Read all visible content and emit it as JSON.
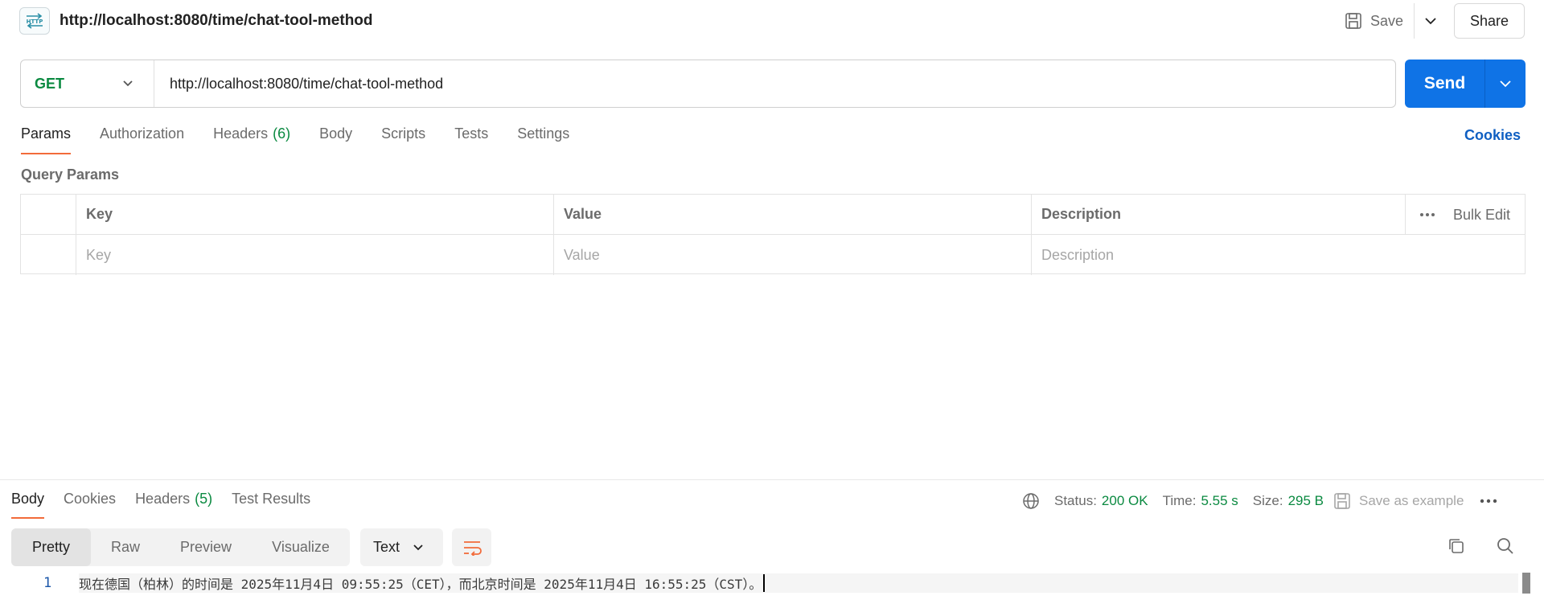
{
  "header": {
    "title": "http://localhost:8080/time/chat-tool-method",
    "save_label": "Save",
    "share_label": "Share"
  },
  "request": {
    "method": "GET",
    "url": "http://localhost:8080/time/chat-tool-method",
    "send_label": "Send"
  },
  "tabs": {
    "params": "Params",
    "authorization": "Authorization",
    "headers": "Headers",
    "headers_count": "(6)",
    "body": "Body",
    "scripts": "Scripts",
    "tests": "Tests",
    "settings": "Settings",
    "cookies": "Cookies"
  },
  "query_params": {
    "label": "Query Params",
    "columns": {
      "key": "Key",
      "value": "Value",
      "description": "Description"
    },
    "bulk_edit": "Bulk Edit",
    "placeholders": {
      "key": "Key",
      "value": "Value",
      "description": "Description"
    }
  },
  "response": {
    "tabs": {
      "body": "Body",
      "cookies": "Cookies",
      "headers": "Headers",
      "headers_count": "(5)",
      "test_results": "Test Results"
    },
    "status_label": "Status:",
    "status_value": "200 OK",
    "time_label": "Time:",
    "time_value": "5.55 s",
    "size_label": "Size:",
    "size_value": "295 B",
    "save_example": "Save as example",
    "views": {
      "pretty": "Pretty",
      "raw": "Raw",
      "preview": "Preview",
      "visualize": "Visualize"
    },
    "format": "Text",
    "line_number": "1",
    "body_text": "现在德国（柏林）的时间是 2025年11月4日 09:55:25（CET），而北京时间是 2025年11月4日 16:55:25（CST）。"
  },
  "colors": {
    "accent_orange": "#f26b3a",
    "send_blue": "#0f73e6",
    "success_green": "#0b8a41",
    "link_blue": "#0f5fc2"
  }
}
